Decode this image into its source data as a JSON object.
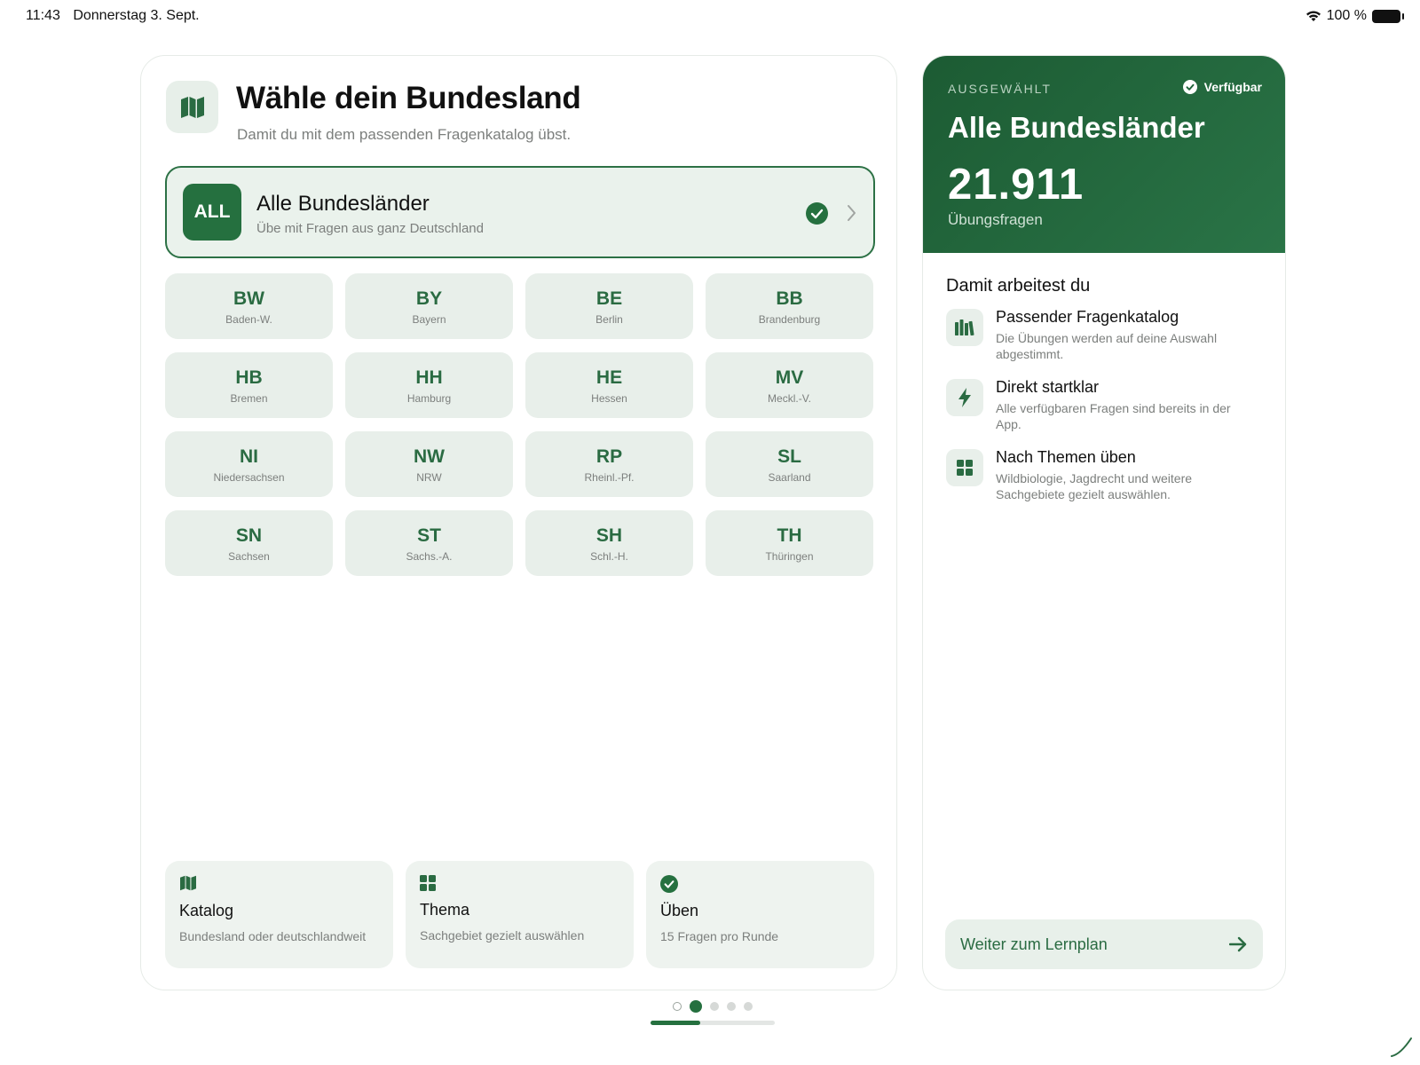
{
  "status_bar": {
    "time": "11:43",
    "date": "Donnerstag 3. Sept.",
    "battery": "100 %"
  },
  "header": {
    "title": "Wähle dein Bundesland",
    "subtitle": "Damit du mit dem passenden Fragenkatalog übst."
  },
  "all_option": {
    "badge": "ALL",
    "title": "Alle Bundesländer",
    "subtitle": "Übe mit Fragen aus ganz Deutschland",
    "selected": true
  },
  "states": [
    {
      "code": "BW",
      "name": "Baden-W."
    },
    {
      "code": "BY",
      "name": "Bayern"
    },
    {
      "code": "BE",
      "name": "Berlin"
    },
    {
      "code": "BB",
      "name": "Brandenburg"
    },
    {
      "code": "HB",
      "name": "Bremen"
    },
    {
      "code": "HH",
      "name": "Hamburg"
    },
    {
      "code": "HE",
      "name": "Hessen"
    },
    {
      "code": "MV",
      "name": "Meckl.-V."
    },
    {
      "code": "NI",
      "name": "Niedersachsen"
    },
    {
      "code": "NW",
      "name": "NRW"
    },
    {
      "code": "RP",
      "name": "Rheinl.-Pf."
    },
    {
      "code": "SL",
      "name": "Saarland"
    },
    {
      "code": "SN",
      "name": "Sachsen"
    },
    {
      "code": "ST",
      "name": "Sachs.-A."
    },
    {
      "code": "SH",
      "name": "Schl.-H."
    },
    {
      "code": "TH",
      "name": "Thüringen"
    }
  ],
  "features": [
    {
      "icon": "map-icon",
      "title": "Katalog",
      "subtitle": "Bundesland oder deutschlandweit"
    },
    {
      "icon": "grid-icon",
      "title": "Thema",
      "subtitle": "Sachgebiet gezielt auswählen"
    },
    {
      "icon": "check-circle-icon",
      "title": "Üben",
      "subtitle": "15 Fragen pro Runde"
    }
  ],
  "summary": {
    "eyebrow": "AUSGEWÄHLT",
    "status": "Verfügbar",
    "title": "Alle Bundesländer",
    "count": "21.911",
    "count_label": "Übungsfragen"
  },
  "info": {
    "section_title": "Damit arbeitest du",
    "items": [
      {
        "icon": "books-icon",
        "title": "Passender Fragenkatalog",
        "desc": "Die Übungen werden auf deine Auswahl abgestimmt."
      },
      {
        "icon": "bolt-icon",
        "title": "Direkt startklar",
        "desc": "Alle verfügbaren Fragen sind bereits in der App."
      },
      {
        "icon": "grid-icon",
        "title": "Nach Themen üben",
        "desc": "Wildbiologie, Jagdrecht und weitere Sachgebiete gezielt auswählen."
      }
    ]
  },
  "cta": {
    "label": "Weiter zum Lernplan"
  },
  "pager": {
    "current_page": 2,
    "total_pages": 5,
    "progress": 0.4
  },
  "colors": {
    "accent": "#25703f",
    "accent_light": "#e8efea",
    "muted_text": "#7c7f7d"
  }
}
